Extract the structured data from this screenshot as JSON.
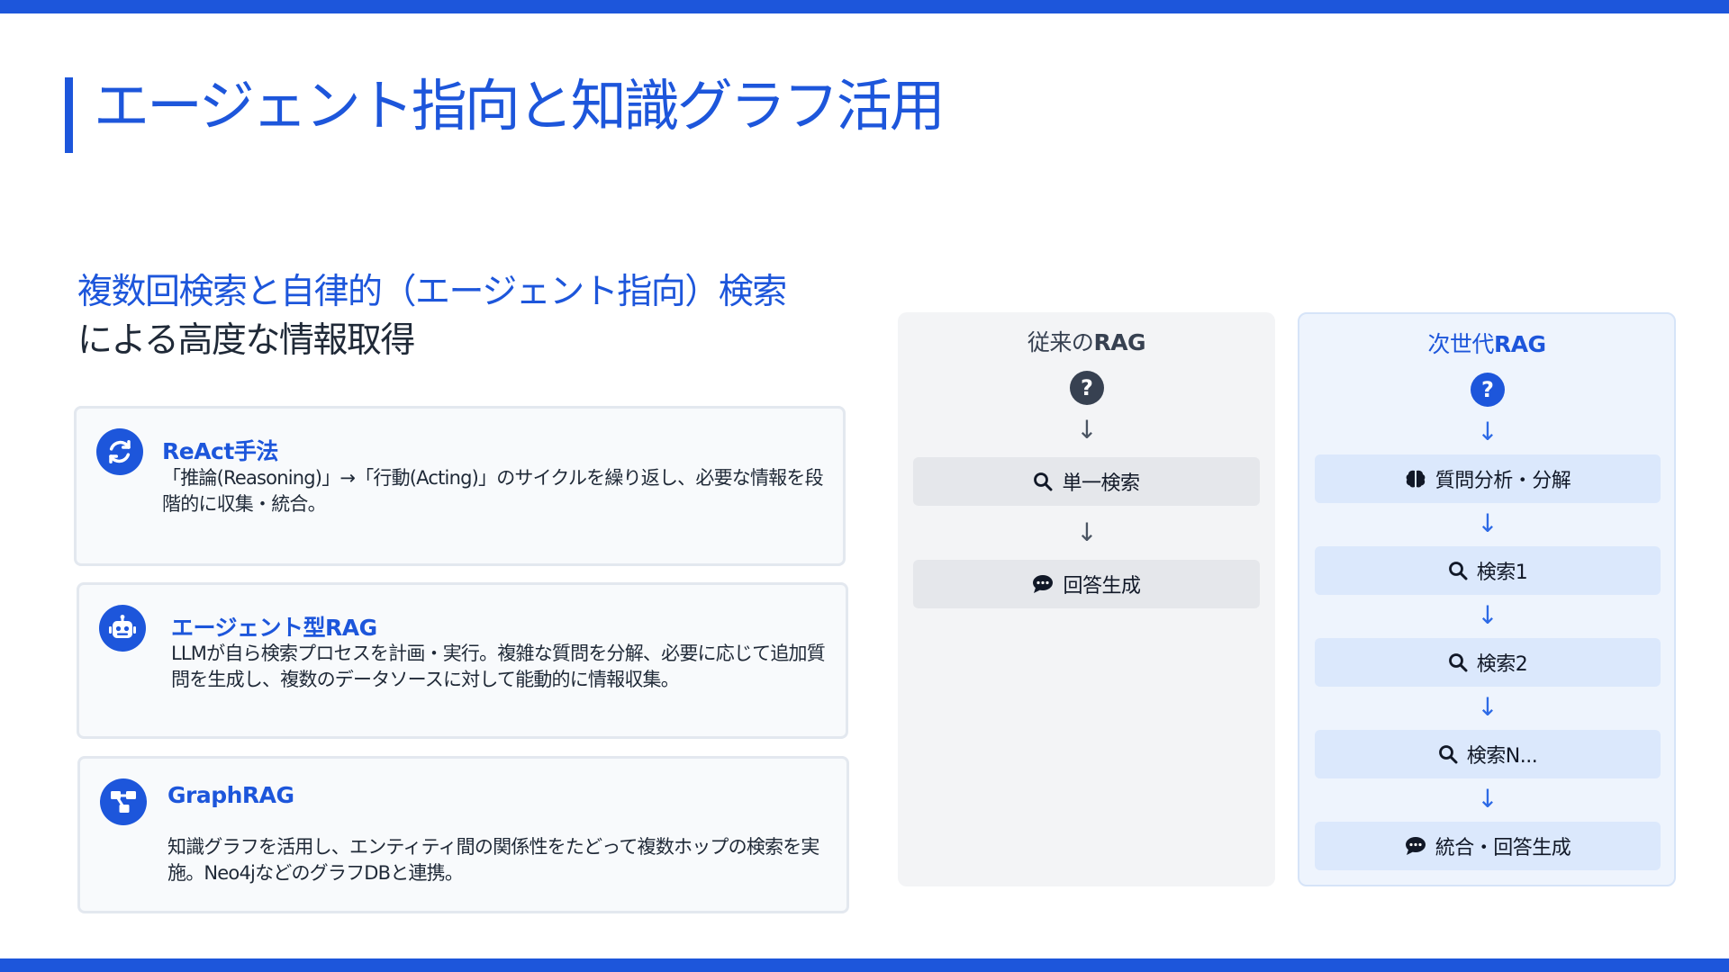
{
  "page": {
    "title": "エージェント指向と知識グラフ活用",
    "subtitle_line1": "複数回検索と自律的（エージェント指向）検索",
    "subtitle_line2": "による高度な情報取得"
  },
  "colors": {
    "accent": "#1d56db",
    "card_bg": "#f8fafc",
    "traditional_bg": "#f3f4f6",
    "next_bg": "#eef4fd"
  },
  "cards": [
    {
      "icon": "refresh-icon",
      "title": "ReAct手法",
      "desc": "「推論(Reasoning)」→「行動(Acting)」のサイクルを繰り返し、必要な情報を段階的に収集・統合。"
    },
    {
      "icon": "robot-icon",
      "title": "エージェント型RAG",
      "desc": "LLMが自ら検索プロセスを計画・実行。複雑な質問を分解、必要に応じて追加質問を生成し、複数のデータソースに対して能動的に情報収集。"
    },
    {
      "icon": "graph-icon",
      "title": "GraphRAG",
      "desc": "知識グラフを活用し、エンティティ間の関係性をたどって複数ホップの検索を実施。Neo4jなどのグラフDBと連携。"
    }
  ],
  "traditional": {
    "title_prefix": "従来の",
    "title_bold": "RAG",
    "question_mark": "?",
    "arrow": "↓",
    "steps": [
      {
        "icon": "search-icon",
        "label": "単一検索"
      },
      {
        "icon": "chat-icon",
        "label": "回答生成"
      }
    ]
  },
  "next_gen": {
    "title_prefix": "次世代",
    "title_bold": "RAG",
    "question_mark": "?",
    "arrow": "↓",
    "steps": [
      {
        "icon": "brain-icon",
        "label": "質問分析・分解"
      },
      {
        "icon": "search-icon",
        "label": "検索1"
      },
      {
        "icon": "search-icon",
        "label": "検索2"
      },
      {
        "icon": "search-icon",
        "label": "検索N..."
      },
      {
        "icon": "chat-icon",
        "label": "統合・回答生成"
      }
    ]
  }
}
